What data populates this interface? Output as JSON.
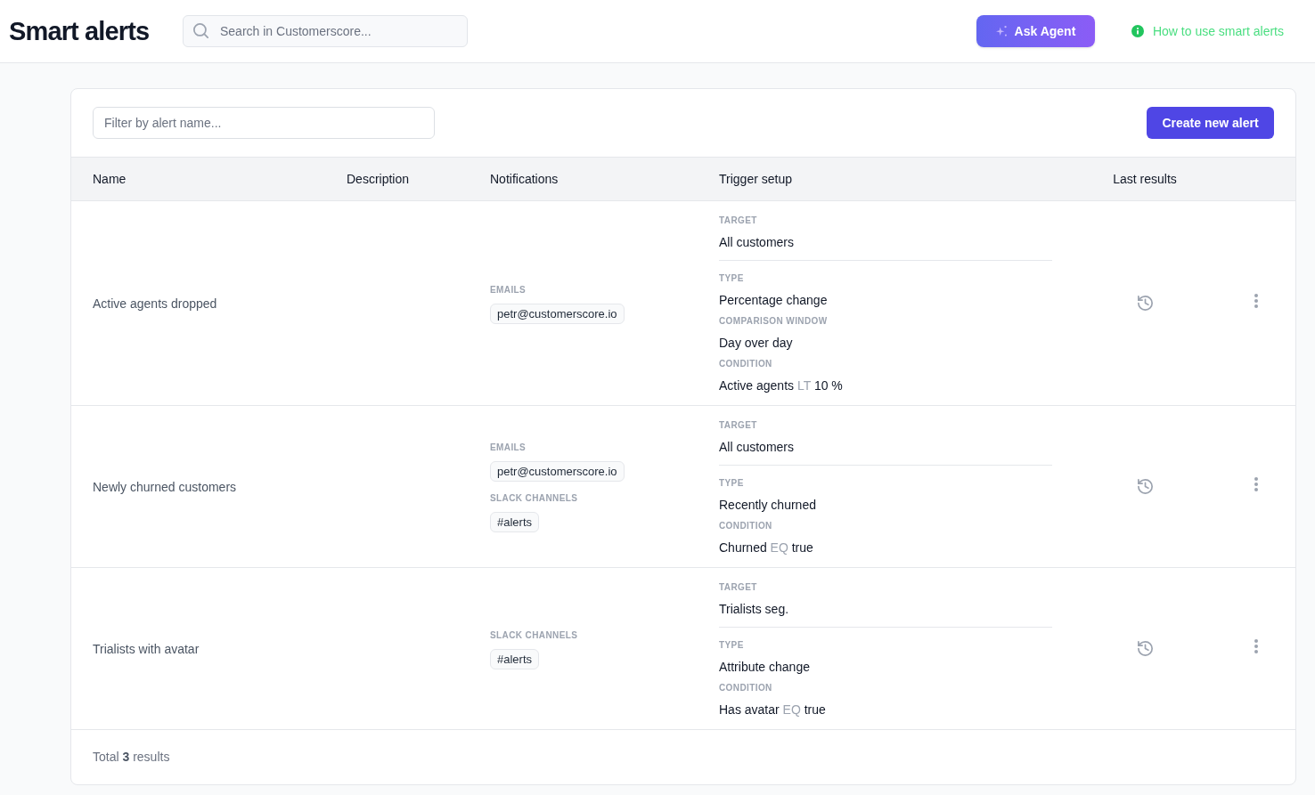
{
  "header": {
    "title": "Smart alerts",
    "search": {
      "placeholder": "Search in Customerscore..."
    },
    "ask_button": "Ask Agent",
    "help_link": "How to use smart alerts"
  },
  "toolbar": {
    "filter": {
      "placeholder": "Filter by alert name..."
    },
    "create_button": "Create new alert"
  },
  "table": {
    "columns": [
      "Name",
      "Description",
      "Notifications",
      "Trigger setup",
      "Last results"
    ],
    "rows": [
      {
        "name": "Active agents dropped",
        "notifications": [
          {
            "label": "EMAILS",
            "items": [
              "petr@customerscore.io"
            ]
          }
        ],
        "trigger": {
          "sections": [
            {
              "fields": [
                {
                  "kind": "text",
                  "label": "TARGET",
                  "value": "All customers"
                }
              ]
            },
            {
              "fields": [
                {
                  "kind": "text",
                  "label": "TYPE",
                  "value": "Percentage change"
                },
                {
                  "kind": "text",
                  "label": "COMPARISON WINDOW",
                  "value": "Day over day"
                },
                {
                  "kind": "condition",
                  "label": "CONDITION",
                  "field": "Active agents",
                  "operator": "LT",
                  "value": "10 %"
                }
              ]
            }
          ]
        }
      },
      {
        "name": "Newly churned customers",
        "notifications": [
          {
            "label": "EMAILS",
            "items": [
              "petr@customerscore.io"
            ]
          },
          {
            "label": "SLACK CHANNELS",
            "items": [
              "#alerts"
            ]
          }
        ],
        "trigger": {
          "sections": [
            {
              "fields": [
                {
                  "kind": "text",
                  "label": "TARGET",
                  "value": "All customers"
                }
              ]
            },
            {
              "fields": [
                {
                  "kind": "text",
                  "label": "TYPE",
                  "value": "Recently churned"
                },
                {
                  "kind": "condition",
                  "label": "CONDITION",
                  "field": "Churned",
                  "operator": "EQ",
                  "value": "true"
                }
              ]
            }
          ]
        }
      },
      {
        "name": "Trialists with avatar",
        "notifications": [
          {
            "label": "SLACK CHANNELS",
            "items": [
              "#alerts"
            ]
          }
        ],
        "trigger": {
          "sections": [
            {
              "fields": [
                {
                  "kind": "text",
                  "label": "TARGET",
                  "value": "Trialists seg."
                }
              ]
            },
            {
              "fields": [
                {
                  "kind": "text",
                  "label": "TYPE",
                  "value": "Attribute change"
                },
                {
                  "kind": "condition",
                  "label": "CONDITION",
                  "field": "Has avatar",
                  "operator": "EQ",
                  "value": "true"
                }
              ]
            }
          ]
        }
      }
    ]
  },
  "footer": {
    "total": "Total **3** results"
  }
}
